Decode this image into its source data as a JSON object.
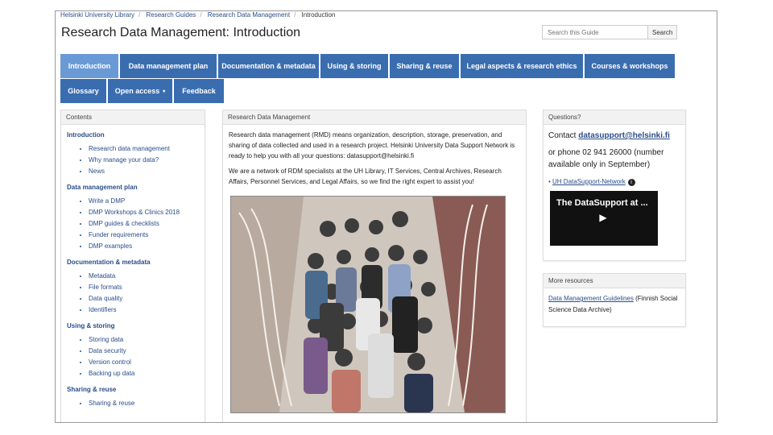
{
  "breadcrumb": [
    "Helsinki University Library",
    "Research Guides",
    "Research Data Management",
    "Introduction"
  ],
  "title": "Research Data Management: Introduction",
  "search": {
    "placeholder": "Search this Guide",
    "button": "Search"
  },
  "tabs_row1": [
    "Introduction",
    "Data management plan",
    "Documentation & metadata",
    "Using & storing",
    "Sharing & reuse",
    "Legal aspects & research ethics",
    "Courses & workshops"
  ],
  "tabs_row2": [
    "Glossary",
    "Open access",
    "Feedback"
  ],
  "toc": {
    "heading": "Contents",
    "sections": [
      {
        "title": "Introduction",
        "items": [
          "Research data management",
          "Why manage your data?",
          "News"
        ]
      },
      {
        "title": "Data management plan",
        "items": [
          "Write a DMP",
          "DMP Workshops & Clinics 2018",
          "DMP guides & checklists",
          "Funder requirements",
          "DMP examples"
        ]
      },
      {
        "title": "Documentation & metadata",
        "items": [
          "Metadata",
          "File formats",
          "Data quality",
          "Identifiers"
        ]
      },
      {
        "title": "Using & storing",
        "items": [
          "Storing data",
          "Data security",
          "Version control",
          "Backing up data"
        ]
      },
      {
        "title": "Sharing & reuse",
        "items": [
          "Sharing & reuse"
        ]
      }
    ]
  },
  "main": {
    "heading": "Research Data Management",
    "p1": "Research data management (RMD) means organization, description, storage, preservation, and sharing of data collected and used in a research project. Helsinki University Data Support Network is ready to help you with all your questions: datasupport@helsinki.fi",
    "p2": "We are a network of RDM specialists at the UH Library, IT Services, Central Archives, Research Affairs, Personnel Services, and Legal Affairs, so we find the right expert to assist you!"
  },
  "questions": {
    "heading": "Questions?",
    "contact_prefix": "Contact ",
    "email": "datasupport@helsinki.fi",
    "phone": "or phone 02 941 26000 (number available only in September)",
    "link": "UH DataSupport-Network",
    "video_title": "The DataSupport at ..."
  },
  "more": {
    "heading": "More resources",
    "link": "Data Management Guidelines",
    "link_suffix": " (Finnish Social Science Data Archive)"
  },
  "colors": {
    "tab": "#3a6db0",
    "tab_active": "#6a9ad6",
    "link": "#2a4d8a"
  }
}
